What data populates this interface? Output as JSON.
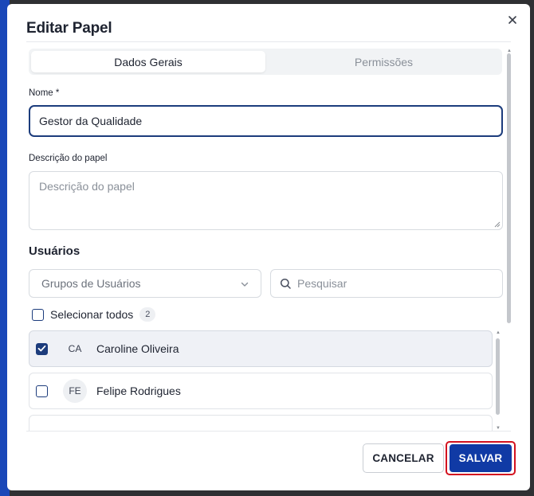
{
  "dialog": {
    "title": "Editar Papel"
  },
  "tabs": [
    {
      "label": "Dados Gerais",
      "active": true
    },
    {
      "label": "Permissões",
      "active": false
    }
  ],
  "form": {
    "nome_label": "Nome *",
    "nome_value": "Gestor da Qualidade",
    "descricao_label": "Descrição do papel",
    "descricao_placeholder": "Descrição do papel"
  },
  "usuarios": {
    "title": "Usuários",
    "groups_placeholder": "Grupos de Usuários",
    "search_placeholder": "Pesquisar",
    "select_all_label": "Selecionar todos",
    "count": "2",
    "list": [
      {
        "initials": "CA",
        "name": "Caroline Oliveira",
        "checked": true
      },
      {
        "initials": "FE",
        "name": "Felipe Rodrigues",
        "checked": false
      }
    ]
  },
  "footer": {
    "cancel_label": "CANCELAR",
    "save_label": "SALVAR"
  },
  "colors": {
    "primary": "#103aa5",
    "focus_border": "#1c3c7c",
    "highlight": "#d3121f"
  }
}
